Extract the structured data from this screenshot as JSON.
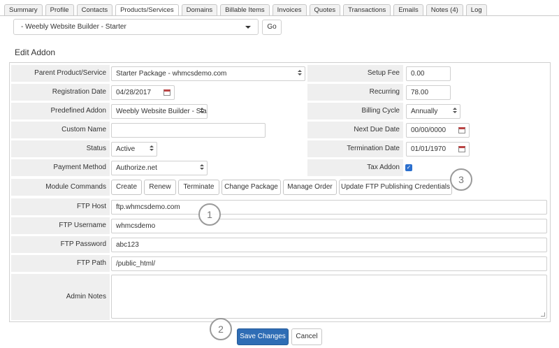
{
  "tabs": [
    "Summary",
    "Profile",
    "Contacts",
    "Products/Services",
    "Domains",
    "Billable Items",
    "Invoices",
    "Quotes",
    "Transactions",
    "Emails",
    "Notes (4)",
    "Log"
  ],
  "addon_selector": {
    "value": "- Weebly Website Builder - Starter",
    "go_label": "Go"
  },
  "section_title": "Edit Addon",
  "form": {
    "parent_product": {
      "label": "Parent Product/Service",
      "value": "Starter Package - whmcsdemo.com"
    },
    "setup_fee": {
      "label": "Setup Fee",
      "value": "0.00"
    },
    "registration_date": {
      "label": "Registration Date",
      "value": "04/28/2017"
    },
    "recurring": {
      "label": "Recurring",
      "value": "78.00"
    },
    "predefined_addon": {
      "label": "Predefined Addon",
      "value": "Weebly Website Builder - Sta"
    },
    "billing_cycle": {
      "label": "Billing Cycle",
      "value": "Annually"
    },
    "custom_name": {
      "label": "Custom Name",
      "value": ""
    },
    "next_due_date": {
      "label": "Next Due Date",
      "value": "00/00/0000"
    },
    "status": {
      "label": "Status",
      "value": "Active"
    },
    "termination_date": {
      "label": "Termination Date",
      "value": "01/01/1970"
    },
    "payment_method": {
      "label": "Payment Method",
      "value": "Authorize.net"
    },
    "tax_addon": {
      "label": "Tax Addon",
      "checked": true,
      "check_glyph": "✓"
    },
    "module_commands": {
      "label": "Module Commands",
      "buttons": [
        "Create",
        "Renew",
        "Terminate",
        "Change Package",
        "Manage Order",
        "Update FTP Publishing Credentials"
      ]
    },
    "ftp_host": {
      "label": "FTP Host",
      "value": "ftp.whmcsdemo.com"
    },
    "ftp_username": {
      "label": "FTP Username",
      "value": "whmcsdemo"
    },
    "ftp_password": {
      "label": "FTP Password",
      "value": "abc123"
    },
    "ftp_path": {
      "label": "FTP Path",
      "value": "/public_html/"
    },
    "admin_notes": {
      "label": "Admin Notes",
      "value": ""
    }
  },
  "callouts": [
    "1",
    "2",
    "3"
  ],
  "actions": {
    "save_label": "Save Changes",
    "cancel_label": "Cancel"
  },
  "colors": {
    "primary_button": "#2f6db5",
    "label_bg": "#efefef",
    "checkbox": "#2b6fce"
  }
}
